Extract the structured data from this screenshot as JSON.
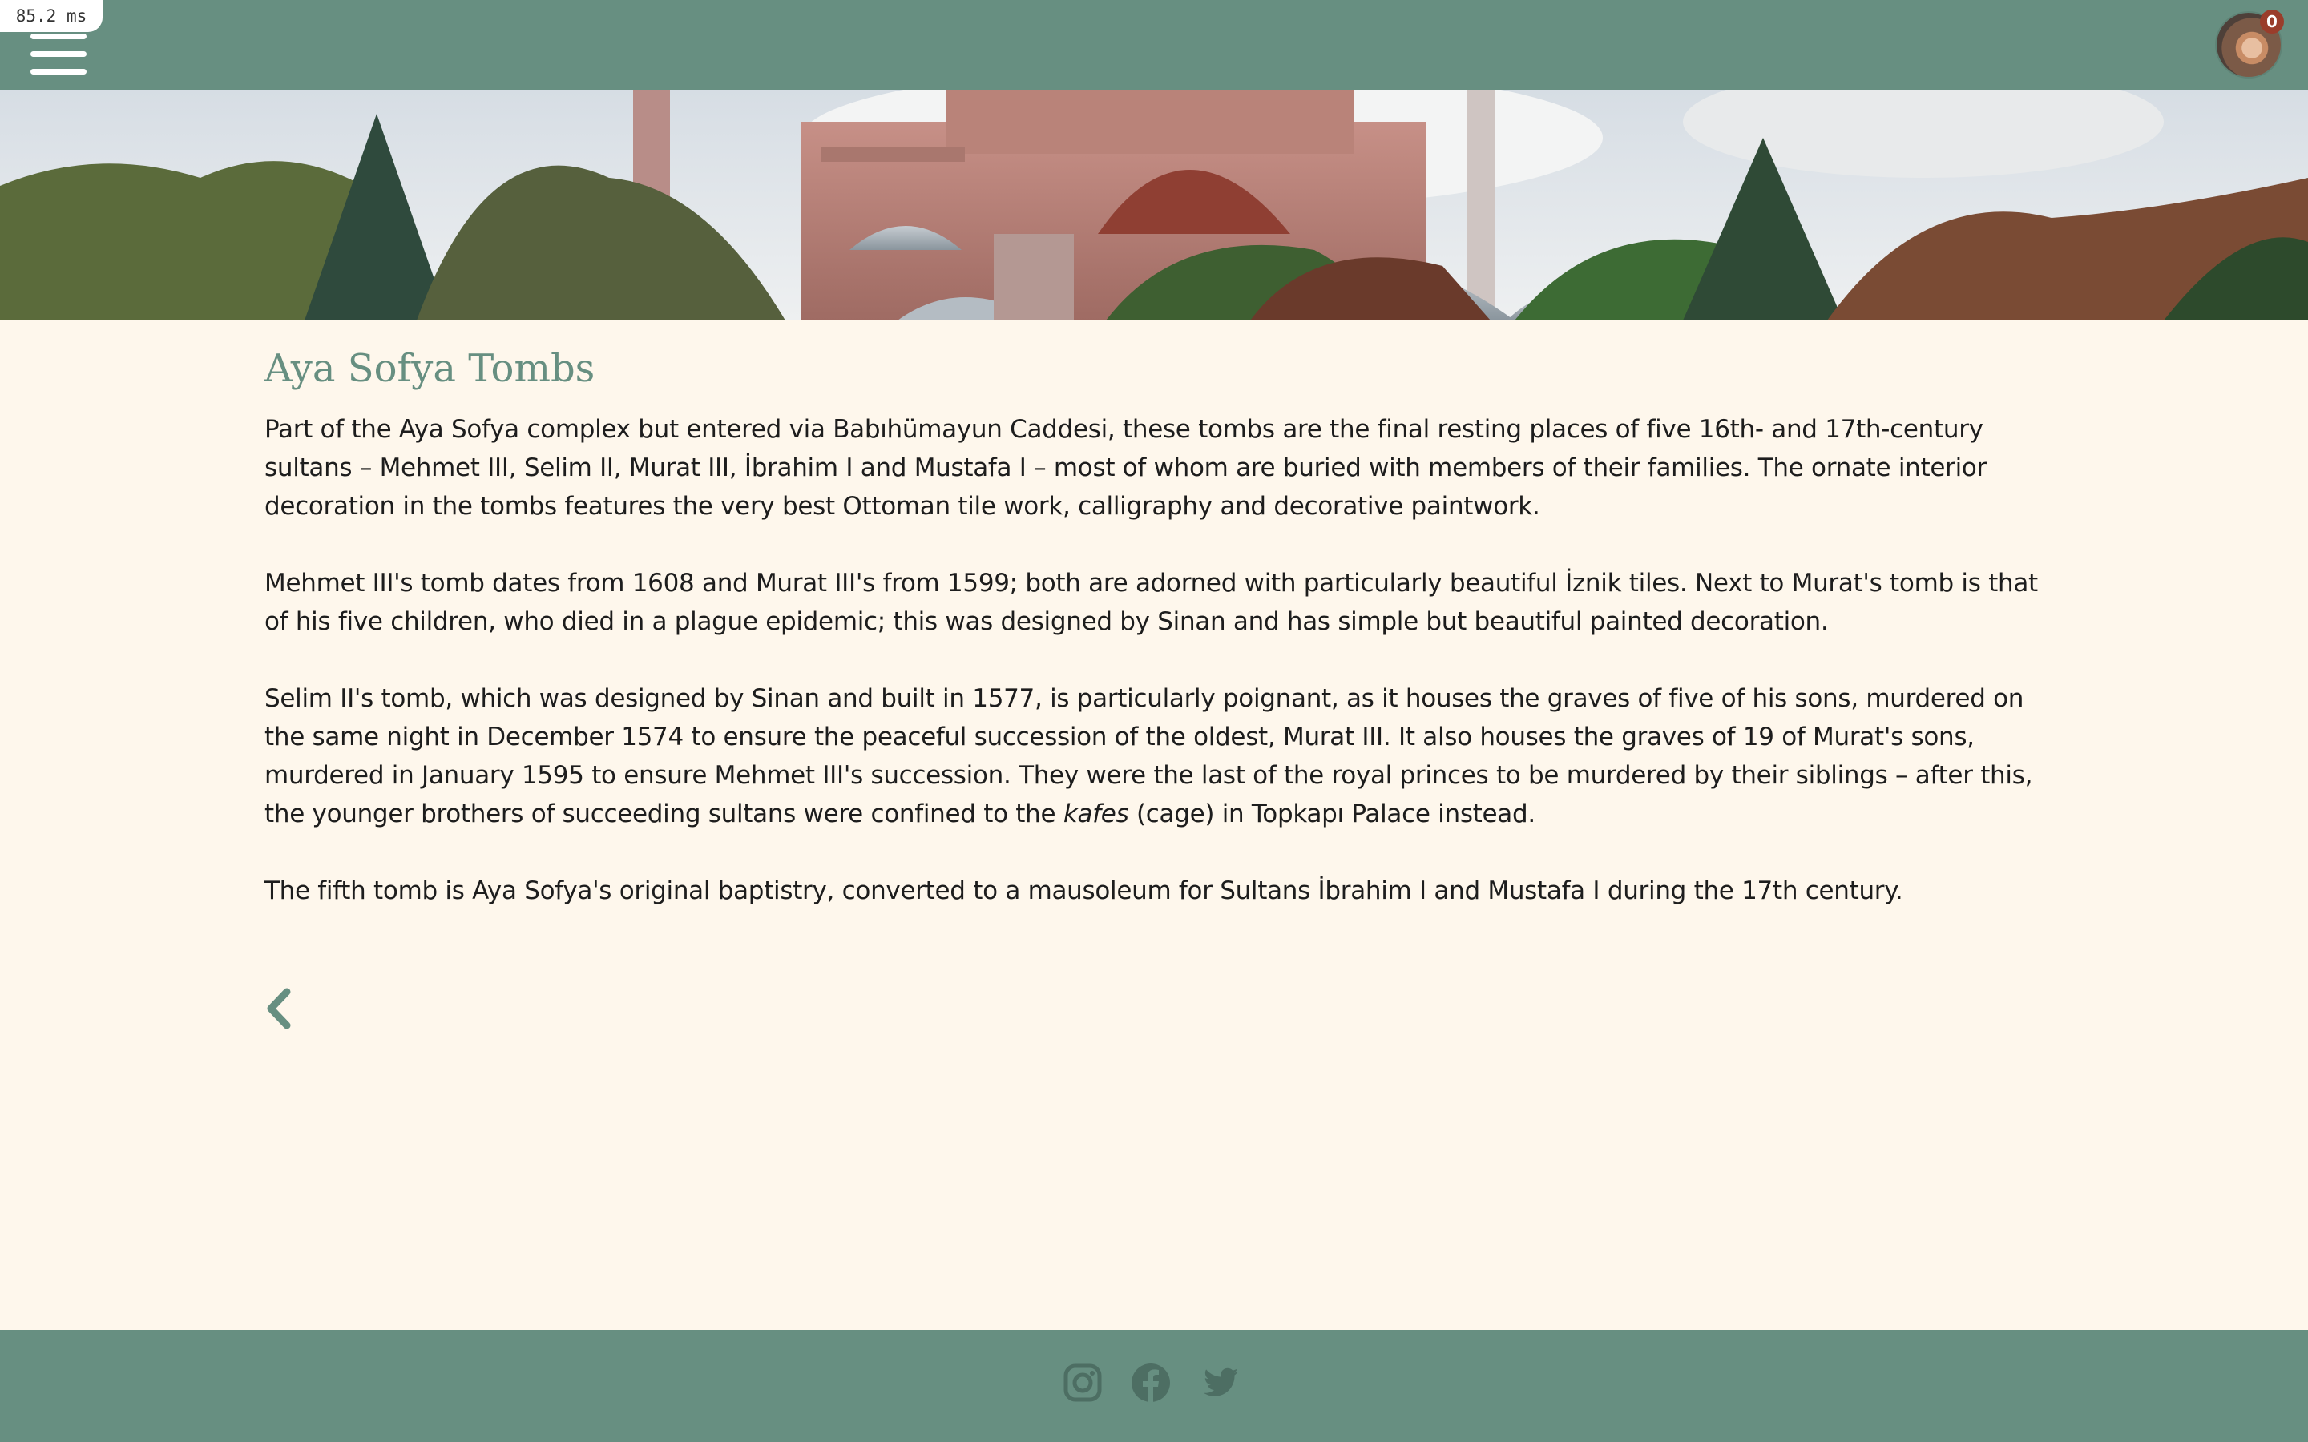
{
  "debug": {
    "timing": "85.2 ms"
  },
  "header": {
    "menu_icon": "hamburger-menu-icon",
    "avatar_icon": "user-avatar",
    "cart_count": "0"
  },
  "article": {
    "title": "Aya Sofya Tombs",
    "paragraphs": [
      "Part of the Aya Sofya complex but entered via Babıhümayun Caddesi, these tombs are the final resting places of five 16th- and 17th-century sultans – Mehmet III, Selim II, Murat III, İbrahim I and Mustafa I – most of whom are buried with members of their families. The ornate interior decoration in the tombs features the very best Ottoman tile work, calligraphy and decorative paintwork.",
      "Mehmet III's tomb dates from 1608 and Murat III's from 1599; both are adorned with particularly beautiful İznik tiles. Next to Murat's tomb is that of his five children, who died in a plague epidemic; this was designed by Sinan and has simple but beautiful painted decoration."
    ],
    "p3": {
      "before": "Selim II's tomb, which was designed by Sinan and built in 1577, is particularly poignant, as it houses the graves of five of his sons, murdered on the same night in December 1574 to ensure the peaceful succession of the oldest, Murat III. It also houses the graves of 19 of Murat's sons, murdered in January 1595 to ensure Mehmet III's succession. They were the last of the royal princes to be murdered by their siblings – after this, the younger brothers of succeeding sultans were confined to the ",
      "italic": "kafes",
      "after": " (cage) in Topkapı Palace instead."
    },
    "p4": "The fifth tomb is Aya Sofya's original baptistry, converted to a mausoleum for Sultans İbrahim I and Mustafa I during the 17th century.",
    "back_icon": "chevron-left-icon"
  },
  "footer": {
    "social_icons": [
      "instagram-icon",
      "facebook-icon",
      "twitter-icon"
    ]
  },
  "colors": {
    "brand": "#678f81",
    "background": "#fef7ec",
    "badge": "#9a3d2b",
    "social_icon": "#4d6e63"
  }
}
